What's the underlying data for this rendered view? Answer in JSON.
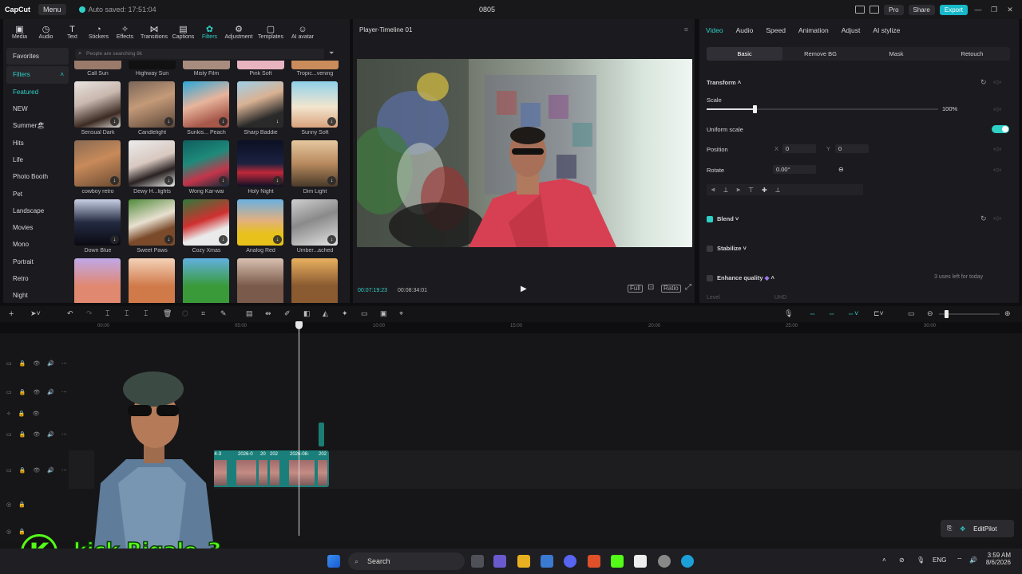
{
  "titlebar": {
    "logo": "CapCut",
    "menu": "Menu",
    "autosave": "Auto saved: 17:51:04",
    "project": "0805",
    "pro": "Pro",
    "share": "Share",
    "export": "Export"
  },
  "toolbar": {
    "items": [
      "Media",
      "Audio",
      "Text",
      "Stickers",
      "Effects",
      "Transitions",
      "Captions",
      "Filters",
      "Adjustment",
      "Templates",
      "AI avatar"
    ],
    "active": "Filters"
  },
  "categories": [
    "Favorites",
    "Filters",
    "Featured",
    "NEW",
    "Summer🏖",
    "Hits",
    "Life",
    "Photo Booth",
    "Pet",
    "Landscape",
    "Movies",
    "Mono",
    "Portrait",
    "Retro",
    "Night"
  ],
  "search": {
    "placeholder": "People are searching 8k"
  },
  "filters": {
    "top_row": [
      "Call Sun",
      "Highway Sun",
      "Misty Film",
      "Pink Soft",
      "Tropic...vening"
    ],
    "rows": [
      [
        "Sensual Dark",
        "Candlelight",
        "Sunkis... Peach",
        "Sharp Baddie",
        "Sunny Soft"
      ],
      [
        "cowboy retro",
        "Dewy H...lights",
        "Wong Kar-wai",
        "Holy Night",
        "Dim Light"
      ],
      [
        "Down Blue",
        "Sweet Paws",
        "Cozy Xmas",
        "Analog Red",
        "Umber...ached"
      ]
    ]
  },
  "player": {
    "title": "Player-Timeline 01",
    "current_time": "00:07:19:23",
    "duration": "00:08:34:01",
    "ctrl_full": "Full",
    "ctrl_ratio": "Ratio"
  },
  "inspector": {
    "tabs": [
      "Video",
      "Audio",
      "Speed",
      "Animation",
      "Adjust",
      "AI stylize"
    ],
    "active_tab": "Video",
    "subtabs": [
      "Basic",
      "Remove BG",
      "Mask",
      "Retouch"
    ],
    "transform": "Transform",
    "scale_label": "Scale",
    "scale_value": "100%",
    "uniform_scale": "Uniform scale",
    "position_label": "Position",
    "pos_x_label": "X",
    "pos_x": "0",
    "pos_y_label": "Y",
    "pos_y": "0",
    "rotate_label": "Rotate",
    "rotate_value": "0.00°",
    "blend": "Blend",
    "stabilize": "Stabilize",
    "enhance": "Enhance quality",
    "enhance_note": "3 uses left for today",
    "level": "Level",
    "uhd": "UHD"
  },
  "timeline": {
    "ticks": [
      "00:00",
      "05:00",
      "10:00",
      "15:00",
      "20:00",
      "25:00",
      "30:00"
    ],
    "clip_labels": [
      "2026",
      "2026",
      "2026-08-05 01-34-3",
      "2026-0",
      "20",
      "202",
      "2026-08-",
      "202"
    ]
  },
  "editpilot": "EditPilot",
  "overlay": {
    "brand": "kick.Rigalo_3",
    "brand_letter": "K"
  },
  "taskbar": {
    "search": "Search",
    "lang": "ENG",
    "time": "3:59 AM",
    "date": "8/6/2026"
  },
  "colors": {
    "accent": "#2fd0c5",
    "kick_green": "#53fc18"
  }
}
